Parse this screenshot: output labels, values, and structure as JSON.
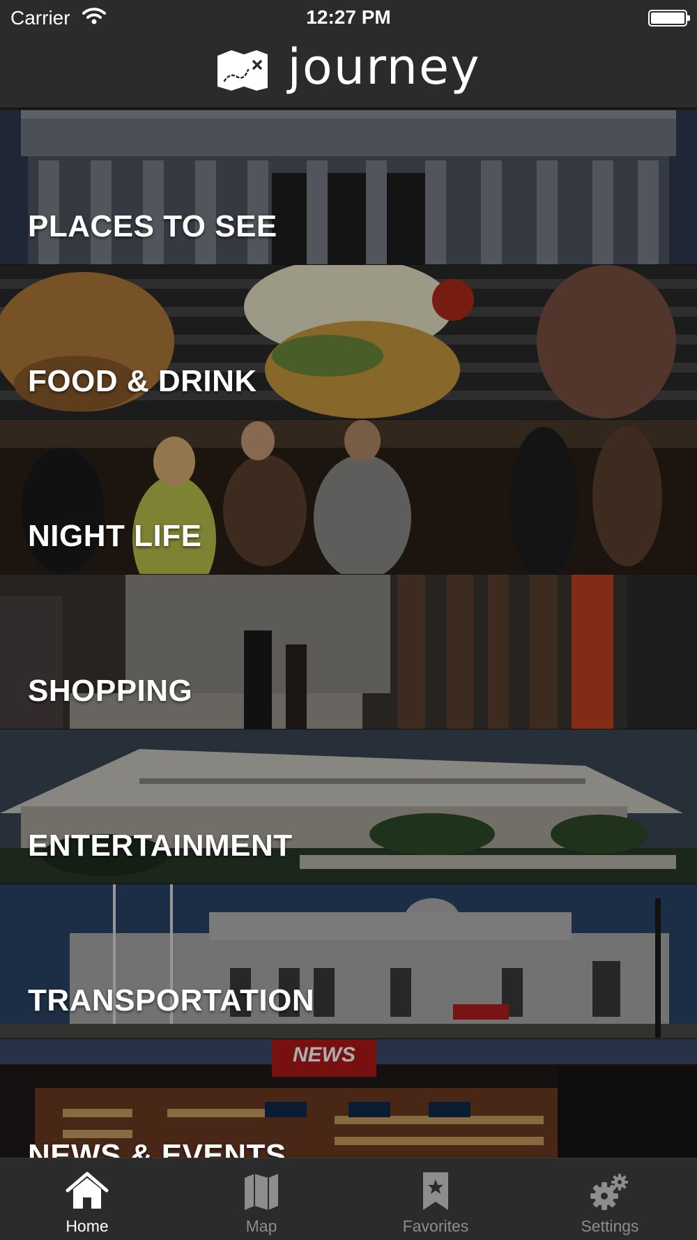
{
  "status_bar": {
    "carrier": "Carrier",
    "time": "12:27 PM"
  },
  "header": {
    "title": "journey",
    "logo_icon": "treasure-map-icon"
  },
  "categories": [
    {
      "label": "PLACES TO SEE"
    },
    {
      "label": "FOOD & DRINK"
    },
    {
      "label": "NIGHT LIFE"
    },
    {
      "label": "SHOPPING"
    },
    {
      "label": "ENTERTAINMENT"
    },
    {
      "label": "TRANSPORTATION"
    },
    {
      "label": "NEWS & EVENTS"
    }
  ],
  "tabbar": {
    "selected": "Home",
    "tabs": [
      {
        "label": "Home",
        "icon": "home-icon"
      },
      {
        "label": "Map",
        "icon": "map-icon"
      },
      {
        "label": "Favorites",
        "icon": "bookmark-star-icon"
      },
      {
        "label": "Settings",
        "icon": "gears-icon"
      }
    ]
  },
  "colors": {
    "bar_background": "#2b2b2b",
    "active_tab": "#ffffff",
    "inactive_tab": "#8d8d8d"
  }
}
